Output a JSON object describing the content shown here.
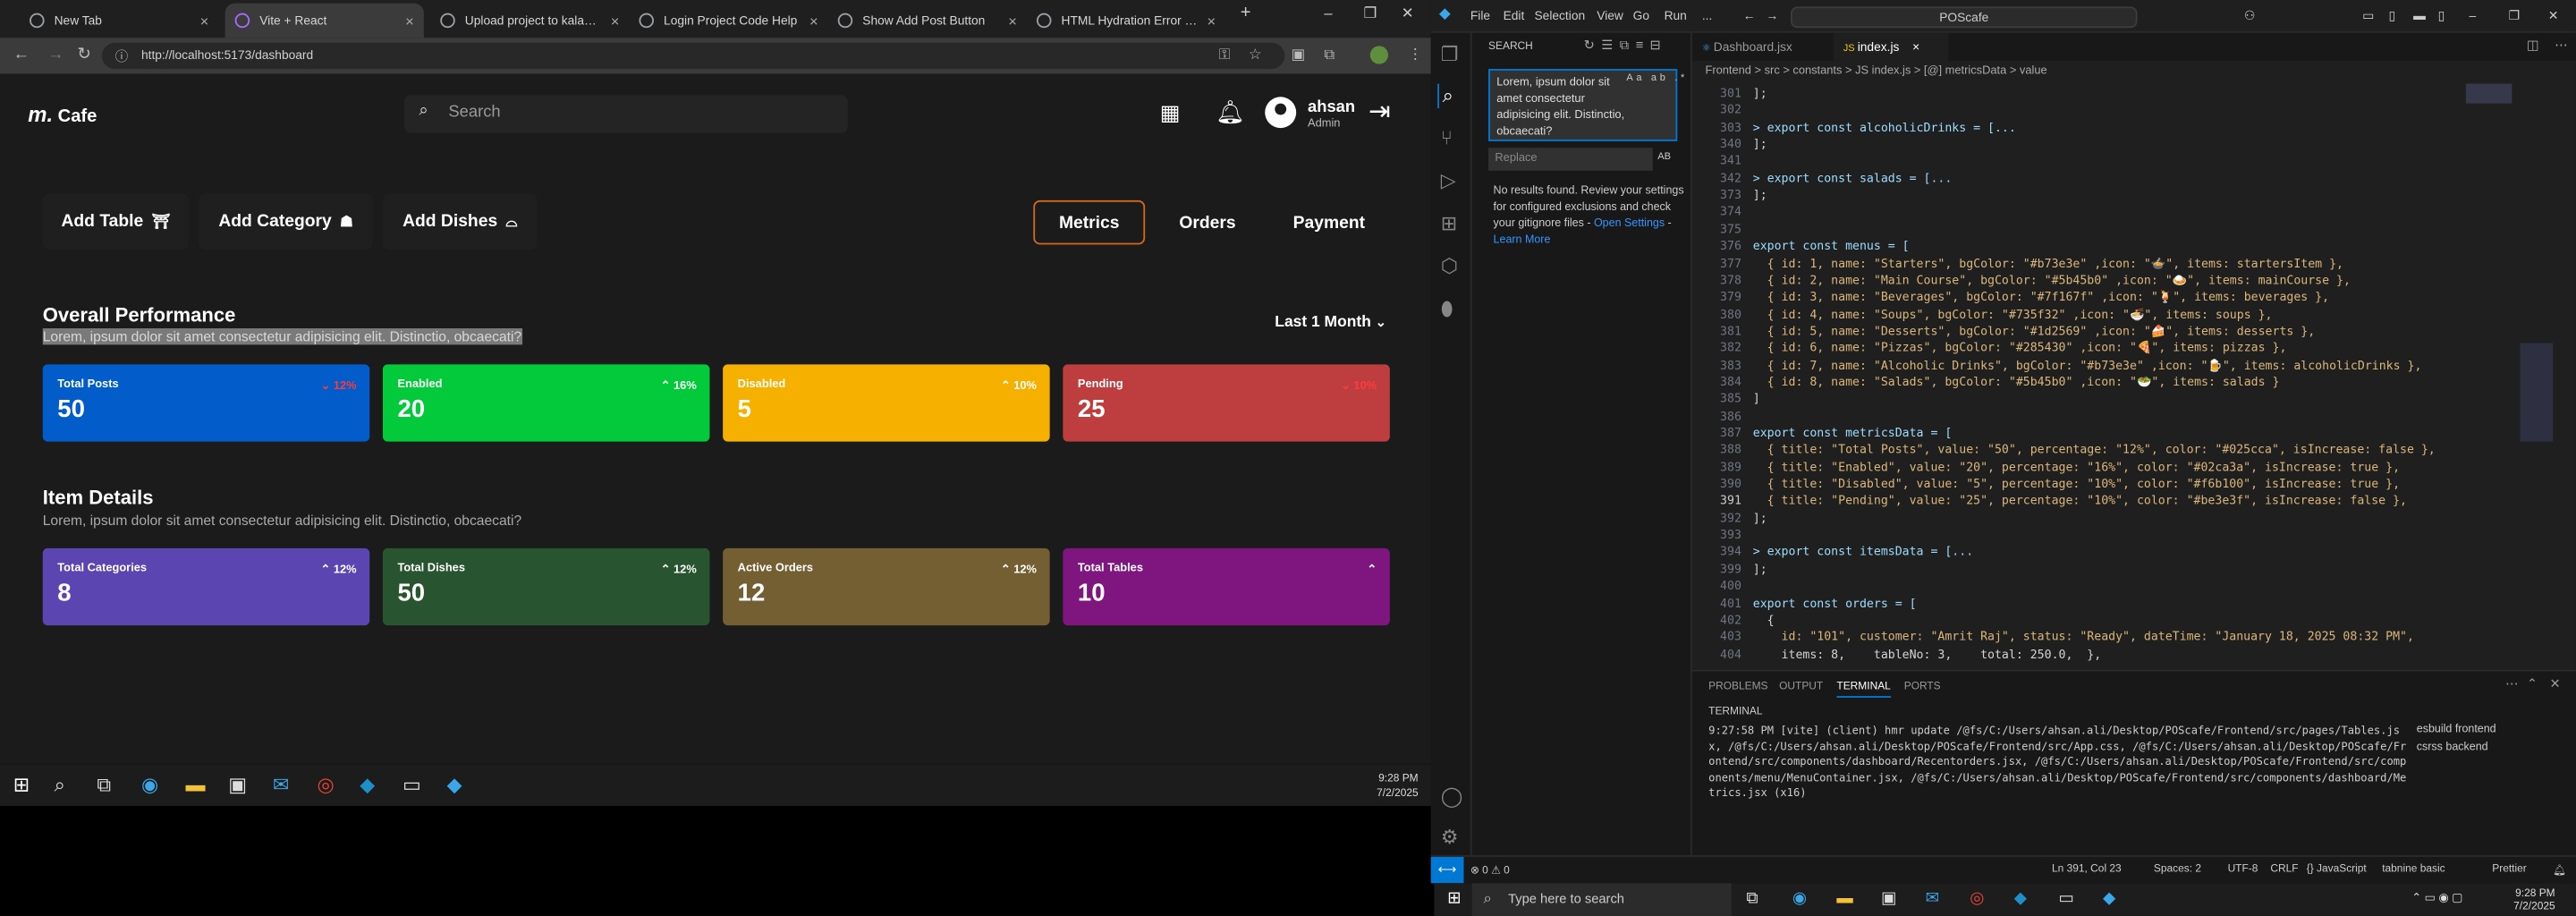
{
  "browser": {
    "tabs": [
      {
        "title": "New Tab",
        "active": false
      },
      {
        "title": "Vite + React",
        "active": true
      },
      {
        "title": "Upload project to kalams.org",
        "active": false
      },
      {
        "title": "Login Project Code Help",
        "active": false
      },
      {
        "title": "Show Add Post Button",
        "active": false
      },
      {
        "title": "HTML Hydration Error Fix",
        "active": false
      }
    ],
    "url": "http://localhost:5173/dashboard"
  },
  "app": {
    "logo": "Cafe",
    "logo_mark": "m.",
    "search_placeholder": "Search",
    "user": {
      "name": "ahsan",
      "role": "Admin"
    },
    "actions": [
      "Add Table",
      "Add Category",
      "Add Dishes"
    ],
    "view_tabs": [
      "Metrics",
      "Orders",
      "Payment"
    ],
    "performance": {
      "title": "Overall Performance",
      "subtitle": "Lorem, ipsum dolor sit amet consectetur adipisicing elit. Distinctio, obcaecati?",
      "period": "Last 1 Month",
      "cards": [
        {
          "title": "Total Posts",
          "value": "50",
          "pct": "12%",
          "up": false,
          "color": "#025cca"
        },
        {
          "title": "Enabled",
          "value": "20",
          "pct": "16%",
          "up": true,
          "color": "#02ca3a"
        },
        {
          "title": "Disabled",
          "value": "5",
          "pct": "10%",
          "up": true,
          "color": "#f6b100"
        },
        {
          "title": "Pending",
          "value": "25",
          "pct": "10%",
          "up": false,
          "color": "#be3e3f"
        }
      ]
    },
    "items": {
      "title": "Item Details",
      "subtitle": "Lorem, ipsum dolor sit amet consectetur adipisicing elit. Distinctio, obcaecati?",
      "cards": [
        {
          "title": "Total Categories",
          "value": "8",
          "pct": "12%",
          "color": "#5b45b0"
        },
        {
          "title": "Total Dishes",
          "value": "50",
          "pct": "12%",
          "color": "#285430"
        },
        {
          "title": "Active Orders",
          "value": "12",
          "pct": "12%",
          "color": "#735f32"
        },
        {
          "title": "Total Tables",
          "value": "10",
          "pct": "",
          "color": "#7f167f"
        }
      ]
    }
  },
  "taskbar_top": {
    "time": "9:28 PM",
    "date": "7/2/2025"
  },
  "vscode": {
    "menus": [
      "File",
      "Edit",
      "Selection",
      "View",
      "Go",
      "Run",
      "..."
    ],
    "command_center": "POScafe",
    "search": {
      "title": "SEARCH",
      "query": "Lorem, ipsum dolor sit amet consectetur adipisicing elit. Distinctio, obcaecati?",
      "replace_placeholder": "Replace",
      "no_results": "No results found. Review your settings for configured exclusions and check your gitignore files -",
      "link1": "Open Settings",
      "link2": "Learn More"
    },
    "editor_tabs": [
      "Dashboard.jsx",
      "index.js"
    ],
    "breadcrumb": "Frontend > src > constants > JS index.js > [@] metricsData > value",
    "code_lines": [
      {
        "n": "301",
        "t": "];"
      },
      {
        "n": "302",
        "t": ""
      },
      {
        "n": "303",
        "t": "> export const alcoholicDrinks = [..."
      },
      {
        "n": "340",
        "t": "];"
      },
      {
        "n": "341",
        "t": ""
      },
      {
        "n": "342",
        "t": "> export const salads = [..."
      },
      {
        "n": "373",
        "t": "];"
      },
      {
        "n": "374",
        "t": ""
      },
      {
        "n": "375",
        "t": ""
      },
      {
        "n": "376",
        "t": "export const menus = ["
      },
      {
        "n": "377",
        "t": "  { id: 1, name: \"Starters\", bgColor: \"#b73e3e\" ,icon: \"🍲\", items: startersItem },"
      },
      {
        "n": "378",
        "t": "  { id: 2, name: \"Main Course\", bgColor: \"#5b45b0\" ,icon: \"🍛\", items: mainCourse },"
      },
      {
        "n": "379",
        "t": "  { id: 3, name: \"Beverages\", bgColor: \"#7f167f\" ,icon: \"🍹\", items: beverages },"
      },
      {
        "n": "380",
        "t": "  { id: 4, name: \"Soups\", bgColor: \"#735f32\" ,icon: \"🍜\", items: soups },"
      },
      {
        "n": "381",
        "t": "  { id: 5, name: \"Desserts\", bgColor: \"#1d2569\" ,icon: \"🍰\", items: desserts },"
      },
      {
        "n": "382",
        "t": "  { id: 6, name: \"Pizzas\", bgColor: \"#285430\" ,icon: \"🍕\", items: pizzas },"
      },
      {
        "n": "383",
        "t": "  { id: 7, name: \"Alcoholic Drinks\", bgColor: \"#b73e3e\" ,icon: \"🍺\", items: alcoholicDrinks },"
      },
      {
        "n": "384",
        "t": "  { id: 8, name: \"Salads\", bgColor: \"#5b45b0\" ,icon: \"🥗\", items: salads }"
      },
      {
        "n": "385",
        "t": "]"
      },
      {
        "n": "386",
        "t": ""
      },
      {
        "n": "387",
        "t": "export const metricsData = ["
      },
      {
        "n": "388",
        "t": "  { title: \"Total Posts\", value: \"50\", percentage: \"12%\", color: \"#025cca\", isIncrease: false },"
      },
      {
        "n": "389",
        "t": "  { title: \"Enabled\", value: \"20\", percentage: \"16%\", color: \"#02ca3a\", isIncrease: true },"
      },
      {
        "n": "390",
        "t": "  { title: \"Disabled\", value: \"5\", percentage: \"10%\", color: \"#f6b100\", isIncrease: true },"
      },
      {
        "n": "391",
        "t": "  { title: \"Pending\", value: \"25\", percentage: \"10%\", color: \"#be3e3f\", isIncrease: false },"
      },
      {
        "n": "392",
        "t": "];"
      },
      {
        "n": "393",
        "t": ""
      },
      {
        "n": "394",
        "t": "> export const itemsData = [..."
      },
      {
        "n": "399",
        "t": "];"
      },
      {
        "n": "400",
        "t": ""
      },
      {
        "n": "401",
        "t": "export const orders = ["
      },
      {
        "n": "402",
        "t": "  {"
      },
      {
        "n": "403",
        "t": "    id: \"101\", customer: \"Amrit Raj\", status: \"Ready\", dateTime: \"January 18, 2025 08:32 PM\","
      },
      {
        "n": "404",
        "t": "    items: 8,    tableNo: 3,    total: 250.0,  },"
      }
    ],
    "panel_tabs": [
      "PROBLEMS",
      "OUTPUT",
      "TERMINAL",
      "PORTS"
    ],
    "terminal_label": "TERMINAL",
    "terminal_text": "9:27:58 PM [vite] (client) hmr update /@fs/C:/Users/ahsan.ali/Desktop/POScafe/Frontend/src/pages/Tables.jsx, /@fs/C:/Users/ahsan.ali/Desktop/POScafe/Frontend/src/App.css, /@fs/C:/Users/ahsan.ali/Desktop/POScafe/Frontend/src/components/dashboard/Recentorders.jsx, /@fs/C:/Users/ahsan.ali/Desktop/POScafe/Frontend/src/components/menu/MenuContainer.jsx, /@fs/C:/Users/ahsan.ali/Desktop/POScafe/Frontend/src/components/dashboard/Metrics.jsx (x16)",
    "terminals": [
      "esbuild frontend",
      "csrss backend"
    ],
    "status_left": "⊗ 0 ⚠ 0",
    "status_right": [
      "Ln 391, Col 23",
      "Spaces: 2",
      "UTF-8",
      "CRLF",
      "{} JavaScript",
      "tabnine basic",
      "Prettier"
    ]
  },
  "taskbar_bottom": {
    "search_placeholder": "Type here to search",
    "time": "9:28 PM",
    "date": "7/2/2025"
  }
}
